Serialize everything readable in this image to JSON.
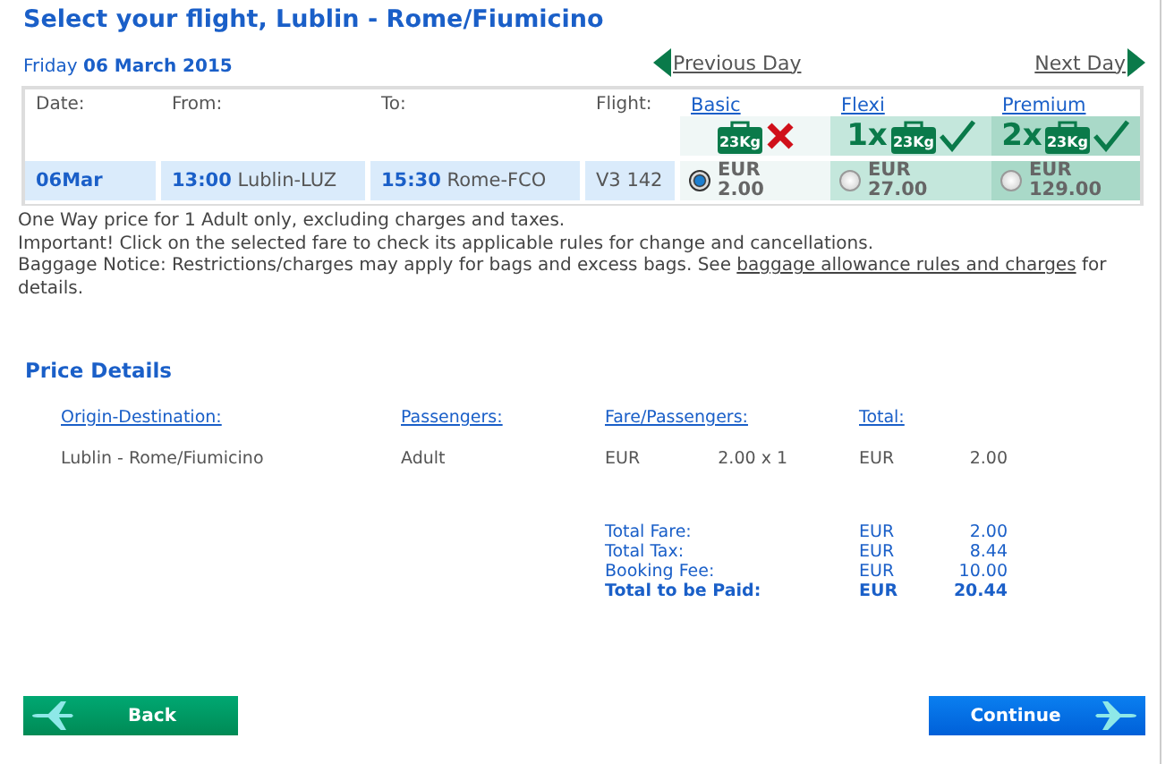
{
  "title": "Select your flight, Lublin - Rome/Fiumicino",
  "date": {
    "weekday": "Friday",
    "date": "06 March 2015"
  },
  "nav": {
    "previous": "Previous Day",
    "next": "Next Day"
  },
  "flight_table": {
    "columns": [
      "Date:",
      "From:",
      "To:",
      "Flight:"
    ],
    "fares": [
      {
        "name": "Basic",
        "bag": "23Kg",
        "included": false
      },
      {
        "name": "Flexi",
        "count": "1x",
        "bag": "23Kg",
        "included": true
      },
      {
        "name": "Premium",
        "count": "2x",
        "bag": "23Kg",
        "included": true
      }
    ],
    "rows": [
      {
        "date": "06Mar",
        "from": "**13:00** Lublin-LUZ",
        "to": "**15:30** Rome-FCO",
        "flight": "V3 142",
        "prices": [
          {
            "currency": "EUR",
            "amount": "2.00",
            "selected": true
          },
          {
            "currency": "EUR",
            "amount": "27.00",
            "selected": false
          },
          {
            "currency": "EUR",
            "amount": "129.00",
            "selected": false
          }
        ]
      }
    ]
  },
  "notes": [
    {
      "text": "One Way price for 1 Adult only, excluding charges and taxes."
    },
    {
      "text": "Important! Click on the selected fare to check its applicable rules for change and cancellations."
    },
    {
      "text": "Baggage Notice: Restrictions/charges may apply for bags and excess bags. See ",
      "link": "baggage allowance rules and charges",
      "after": " for details."
    }
  ],
  "price_details": {
    "heading": "Price Details",
    "columns": [
      "Origin-Destination:",
      "Passengers:",
      "Fare/Passengers:",
      "Total:"
    ],
    "rows": [
      {
        "route": "Lublin - Rome/Fiumicino",
        "passengers": "Adult",
        "fare_currency": "EUR",
        "fare": "2.00 x 1",
        "total_currency": "EUR",
        "total": "2.00"
      }
    ],
    "totals": [
      {
        "kind": "line",
        "label": "Total Fare:",
        "currency": "EUR",
        "amount": "2.00"
      },
      {
        "kind": "line",
        "label": "Total Tax:",
        "currency": "EUR",
        "amount": "8.44"
      },
      {
        "kind": "line",
        "label": "Booking Fee:",
        "currency": "EUR",
        "amount": "10.00"
      },
      {
        "kind": "grand",
        "label": "Total to be Paid:",
        "currency": "EUR",
        "amount": "20.44"
      }
    ]
  },
  "buttons": {
    "back": "Back",
    "continue": "Continue"
  }
}
